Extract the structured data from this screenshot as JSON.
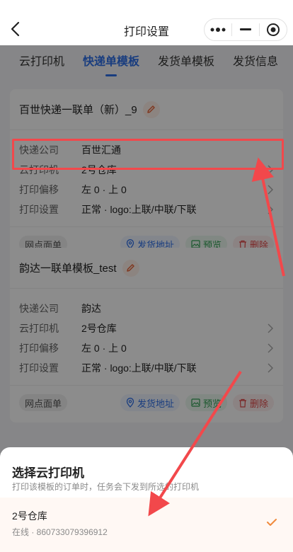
{
  "header": {
    "title": "打印设置"
  },
  "tabs": [
    {
      "label": "云打印机"
    },
    {
      "label": "快递单模板"
    },
    {
      "label": "发货单模板"
    },
    {
      "label": "发货信息"
    }
  ],
  "cards": [
    {
      "name": "百世快递一联单（新）_9",
      "rows": [
        {
          "label": "快递公司",
          "value": "百世汇通"
        },
        {
          "label": "云打印机",
          "value": "2号仓库"
        },
        {
          "label": "打印偏移",
          "value": "左 0 · 上 0"
        },
        {
          "label": "打印设置",
          "value": "正常 · logo:上联/中联/下联"
        }
      ],
      "tag": "网点面单",
      "actions": {
        "address": "发货地址",
        "preview": "预览",
        "delete": "删除"
      }
    },
    {
      "name": "韵达一联单模板_test",
      "rows": [
        {
          "label": "快递公司",
          "value": "韵达"
        },
        {
          "label": "云打印机",
          "value": "2号仓库"
        },
        {
          "label": "打印偏移",
          "value": "左 0 · 上 0"
        },
        {
          "label": "打印设置",
          "value": "正常 · logo:上联/中联/下联"
        }
      ],
      "tag": "网点面单",
      "actions": {
        "address": "发货地址",
        "preview": "预览",
        "delete": "删除"
      }
    }
  ],
  "sheet": {
    "title": "选择云打印机",
    "subtitle": "打印该模板的订单时，任务会下发到所选的打印机",
    "options": [
      {
        "name": "2号仓库",
        "meta": "在线 · 860733079396912",
        "selected": true
      }
    ]
  },
  "colors": {
    "accent": "#2f6fe8",
    "annotation": "#f2484b",
    "check": "#f08a3c"
  }
}
